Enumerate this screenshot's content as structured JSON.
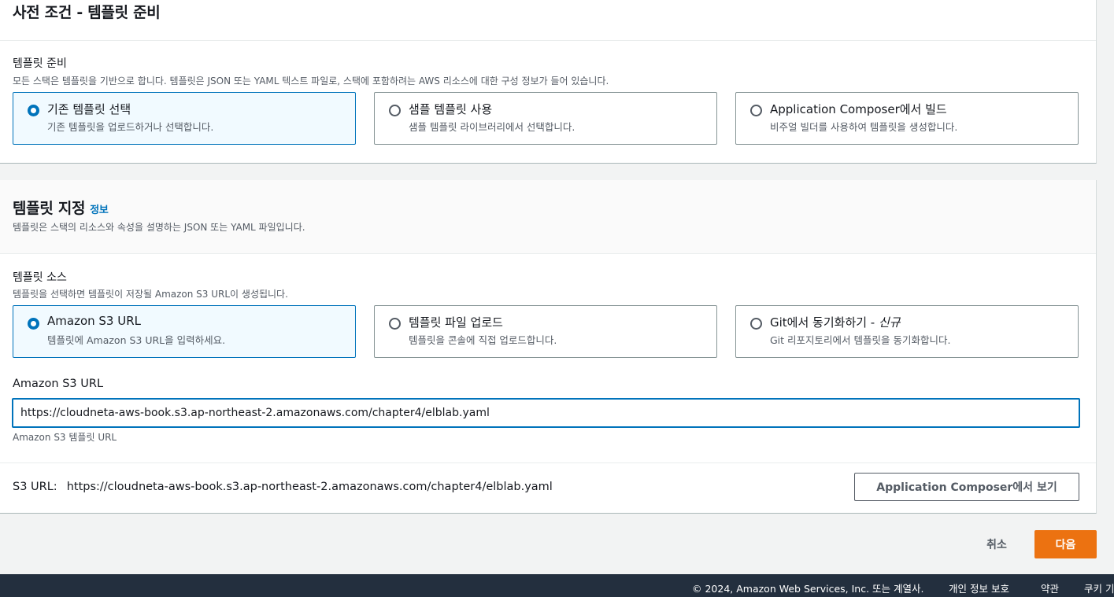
{
  "prereq": {
    "title": "사전 조건 - 템플릿 준비",
    "field_label": "템플릿 준비",
    "field_desc": "모든 스택은 템플릿을 기반으로 합니다. 템플릿은 JSON 또는 YAML 텍스트 파일로, 스택에 포함하려는 AWS 리소스에 대한 구성 정보가 들어 있습니다.",
    "options": [
      {
        "title": "기존 템플릿 선택",
        "desc": "기존 템플릿을 업로드하거나 선택합니다.",
        "selected": true
      },
      {
        "title": "샘플 템플릿 사용",
        "desc": "샘플 템플릿 라이브러리에서 선택합니다.",
        "selected": false
      },
      {
        "title": "Application Composer에서 빌드",
        "desc": "비주얼 빌더를 사용하여 템플릿을 생성합니다.",
        "selected": false
      }
    ]
  },
  "specify": {
    "title": "템플릿 지정",
    "info_link": "정보",
    "desc": "템플릿은 스택의 리소스와 속성을 설명하는 JSON 또는 YAML 파일입니다.",
    "source_label": "템플릿 소스",
    "source_desc": "템플릿을 선택하면 템플릿이 저장될 Amazon S3 URL이 생성됩니다.",
    "sources": [
      {
        "title": "Amazon S3 URL",
        "desc": "템플릿에 Amazon S3 URL을 입력하세요.",
        "selected": true
      },
      {
        "title": "템플릿 파일 업로드",
        "desc": "템플릿을 콘솔에 직접 업로드합니다.",
        "selected": false
      },
      {
        "title": "Git에서 동기화하기 - ",
        "title_badge": "신규",
        "desc": "Git 리포지토리에서 템플릿을 동기화합니다.",
        "selected": false
      }
    ],
    "url_label": "Amazon S3 URL",
    "url_value": "https://cloudneta-aws-book.s3.ap-northeast-2.amazonaws.com/chapter4/elblab.yaml",
    "url_constraint": "Amazon S3 템플릿 URL",
    "s3url_label": "S3 URL:",
    "s3url_value": "https://cloudneta-aws-book.s3.ap-northeast-2.amazonaws.com/chapter4/elblab.yaml",
    "view_button": "Application Composer에서 보기"
  },
  "actions": {
    "cancel": "취소",
    "next": "다음"
  },
  "footer": {
    "copyright": "© 2024, Amazon Web Services, Inc. 또는 계열사.",
    "privacy": "개인 정보 보호",
    "terms": "약관",
    "cookies": "쿠키 기본 설정"
  },
  "colors": {
    "accent": "#0073bb",
    "primary_button": "#ec7211",
    "footer_bg": "#232f3e"
  }
}
